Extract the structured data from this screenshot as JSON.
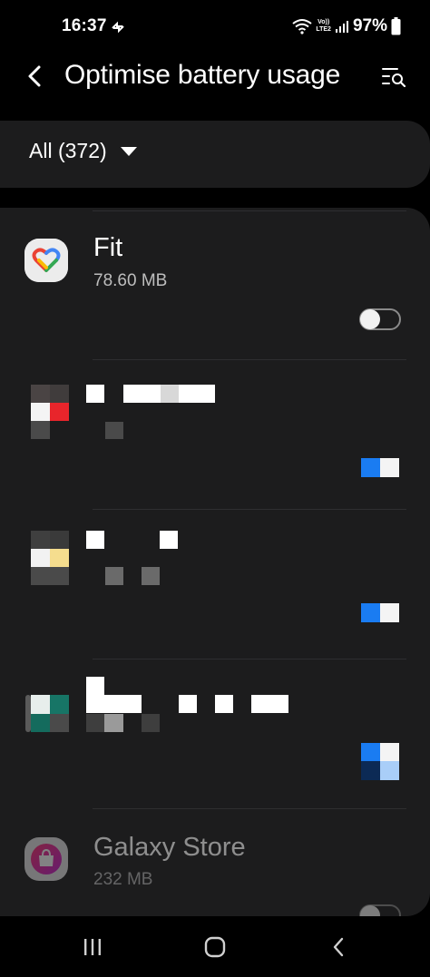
{
  "status_bar": {
    "time": "16:37",
    "lte_top": "Vo))",
    "lte_bottom": "LTE2",
    "battery": "97%"
  },
  "header": {
    "title": "Optimise battery usage",
    "back_icon": "back-arrow-icon",
    "search_icon": "search-list-icon"
  },
  "filter": {
    "label": "All (372)"
  },
  "apps": [
    {
      "name": "Fit",
      "size": "78.60 MB",
      "optimised": false
    },
    {
      "name": "",
      "size": "",
      "optimised": true
    },
    {
      "name": "",
      "size": "",
      "optimised": true
    },
    {
      "name": "",
      "size": "",
      "optimised": true
    },
    {
      "name": "Galaxy Store",
      "size": "232 MB",
      "optimised": false
    }
  ],
  "colors": {
    "background": "#000000",
    "card": "#1c1c1d",
    "accent": "#1a7cf2"
  }
}
